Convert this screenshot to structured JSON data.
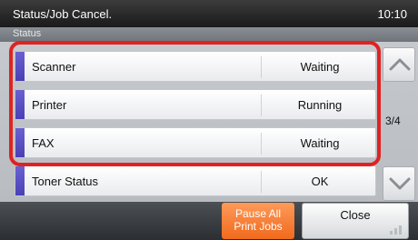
{
  "header": {
    "title": "Status/Job Cancel.",
    "time": "10:10",
    "section": "Status"
  },
  "devices": [
    {
      "name": "Scanner",
      "status": "Waiting"
    },
    {
      "name": "Printer",
      "status": "Running"
    },
    {
      "name": "FAX",
      "status": "Waiting"
    },
    {
      "name": "Toner Status",
      "status": "OK"
    }
  ],
  "pager": {
    "current": 3,
    "total": 4,
    "label": "3/4"
  },
  "buttons": {
    "pause_line1": "Pause All",
    "pause_line2": "Print Jobs",
    "close": "Close"
  },
  "icons": {
    "scroll_up": "chevron-up-icon",
    "scroll_down": "chevron-down-icon"
  },
  "colors": {
    "accent": "#5247c4",
    "highlight": "#e02222",
    "pause_button": "#f57a2e"
  }
}
